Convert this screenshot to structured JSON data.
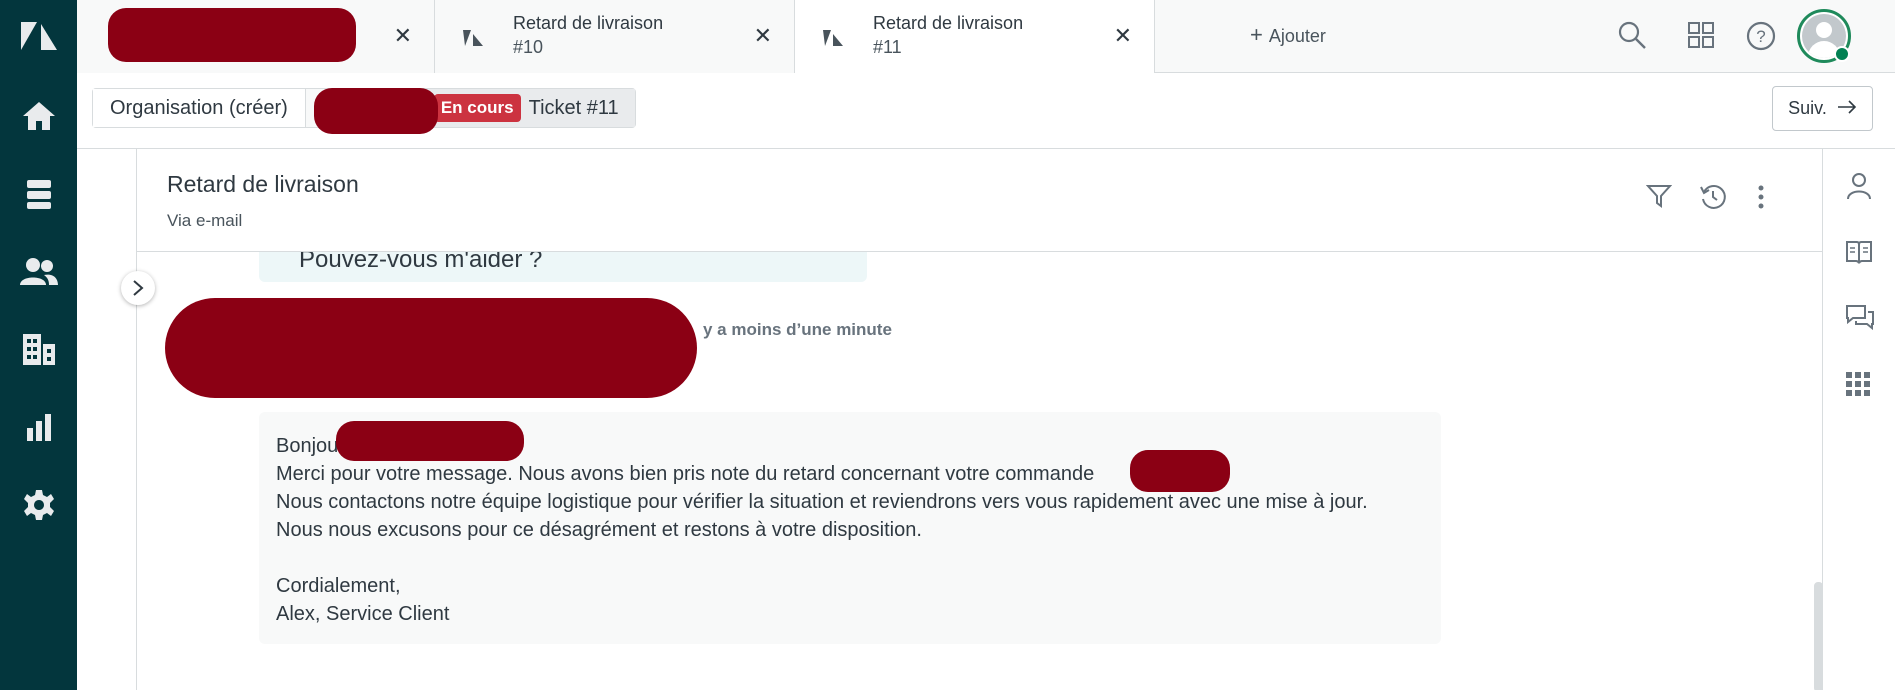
{
  "nav": {
    "items": [
      "logo",
      "home",
      "views",
      "customers",
      "organizations",
      "reporting",
      "admin"
    ]
  },
  "tabs": [
    {
      "title": "",
      "subtitle": "",
      "redacted": true
    },
    {
      "title": "Retard de livraison",
      "subtitle": "#10"
    },
    {
      "title": "Retard de livraison",
      "subtitle": "#11",
      "active": true
    }
  ],
  "add_tab_label": "Ajouter",
  "breadcrumb": {
    "organization": "Organisation (créer)",
    "status_badge": "En cours",
    "ticket": "Ticket #11"
  },
  "next_button": "Suiv.",
  "ticket": {
    "title": "Retard de livraison",
    "via": "Via e-mail",
    "previous_message_tail": "Pouvez-vous m'aider ?",
    "reply_timestamp": "y a moins d’une minute",
    "reply_lines": [
      "Bonjou",
      "Merci pour votre message. Nous avons bien pris note du retard concernant votre commande",
      "Nous contactons notre équipe logistique pour vérifier la situation et reviendrons vers vous rapidement avec une mise à jour.",
      "Nous nous excusons pour ce désagrément et restons à votre disposition.",
      "",
      "Cordialement,",
      "Alex, Service Client"
    ]
  },
  "colors": {
    "nav_bg": "#03363d",
    "badge": "#cc3340",
    "presence": "#038153"
  }
}
